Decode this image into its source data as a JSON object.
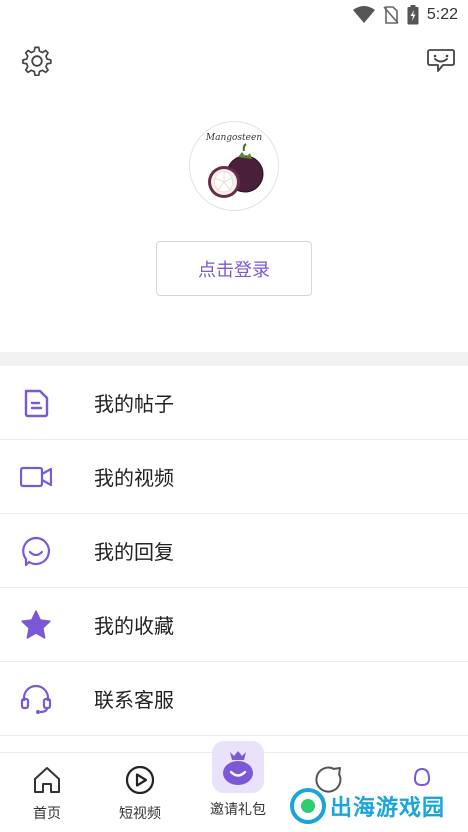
{
  "status_bar": {
    "time": "5:22"
  },
  "profile": {
    "brand_text": "Mangosteen",
    "login_label": "点击登录"
  },
  "menu": [
    {
      "label": "我的帖子",
      "icon": "document-icon"
    },
    {
      "label": "我的视频",
      "icon": "video-camera-icon"
    },
    {
      "label": "我的回复",
      "icon": "reply-bubble-icon"
    },
    {
      "label": "我的收藏",
      "icon": "star-icon"
    },
    {
      "label": "联系客服",
      "icon": "headset-icon"
    }
  ],
  "tabs": [
    {
      "label": "首页",
      "icon": "home-icon"
    },
    {
      "label": "短视频",
      "icon": "play-circle-icon"
    },
    {
      "label": "邀请礼包",
      "icon": "gift-bag-icon"
    },
    {
      "label": "",
      "icon": "discover-icon"
    },
    {
      "label": "",
      "icon": "profile-icon"
    }
  ],
  "watermark": {
    "text": "出海游戏园"
  },
  "colors": {
    "accent": "#7a58d8",
    "divider": "#ececec",
    "band": "#f2f2f2"
  }
}
